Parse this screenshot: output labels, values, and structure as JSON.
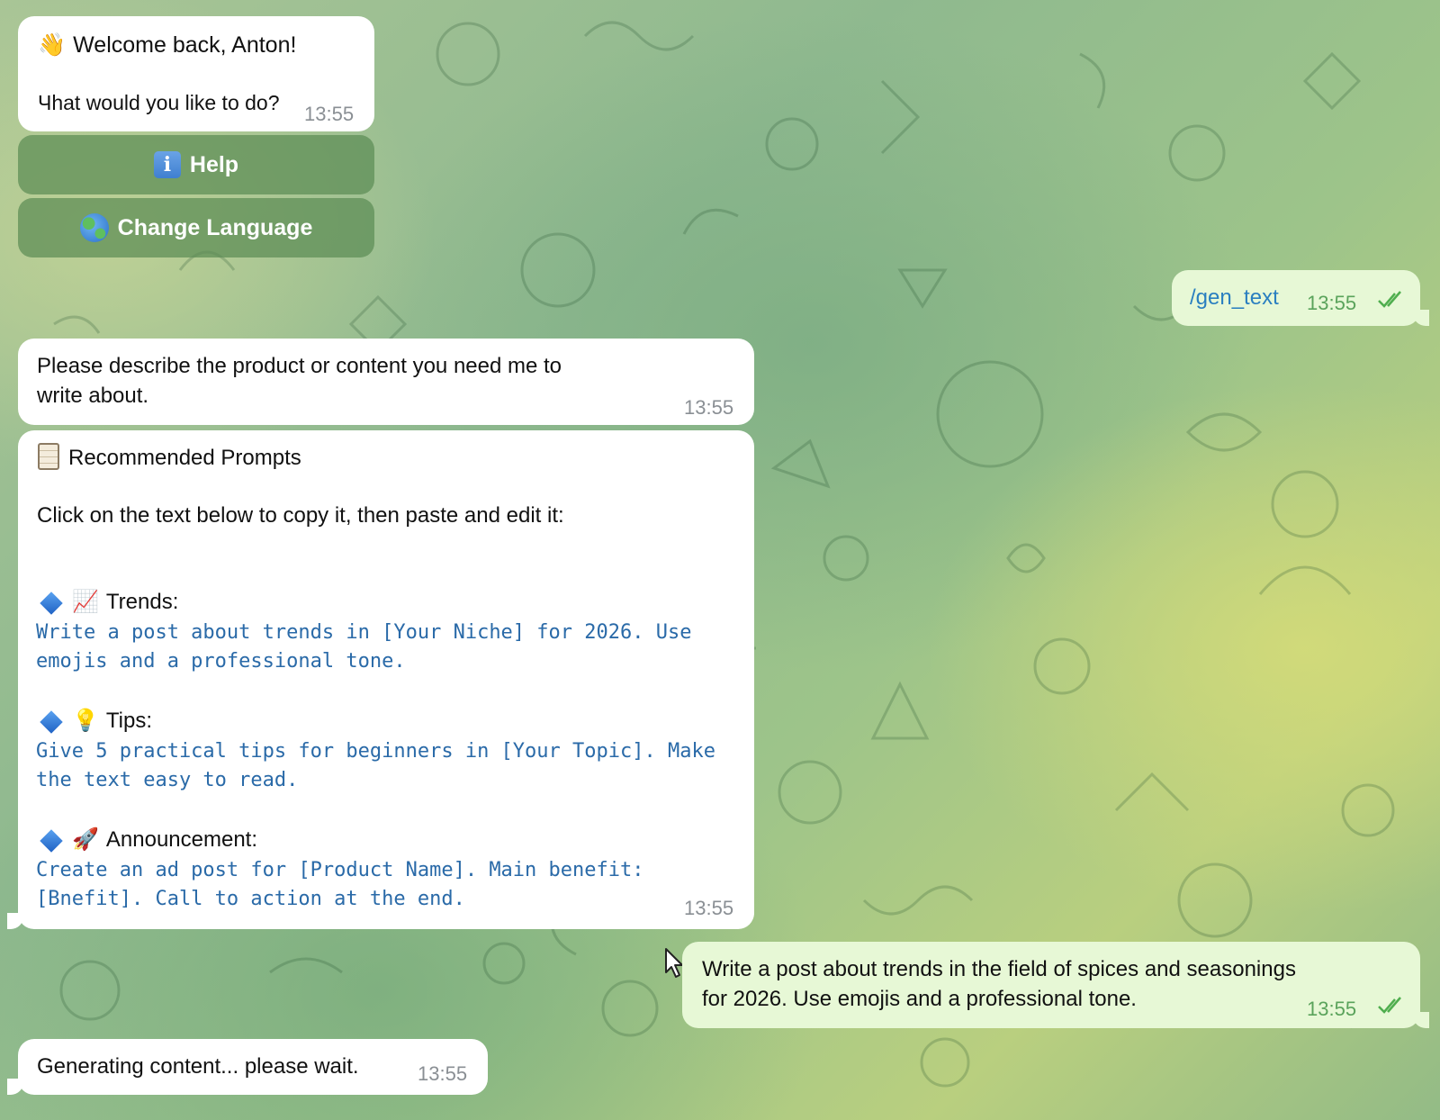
{
  "messages": {
    "welcome": {
      "greeting_emoji": "👋",
      "title": "Welcome back, Anton!",
      "subtitle": "Чhat would you like to do?",
      "time": "13:55"
    },
    "keyboard": {
      "help_label": "Help",
      "help_icon": "info-icon",
      "language_label": "Change Language",
      "language_icon": "globe-icon"
    },
    "command": {
      "text": "/gen_text",
      "time": "13:55"
    },
    "describe": {
      "text_line1": "Please describe the product or content you need me to",
      "text_line2": "write about.",
      "time": "13:55"
    },
    "prompts": {
      "header_icon": "clipboard-icon",
      "header": "Recommended Prompts",
      "instruction": "Click on the text below to copy it, then paste and edit it:",
      "items": [
        {
          "icon": "chart-increasing-icon",
          "emoji": "📈",
          "label": "Trends:",
          "code_line1": "Write a post about trends in [Your Niche] for 2026. Use",
          "code_line2": "emojis and a professional tone."
        },
        {
          "icon": "light-bulb-icon",
          "emoji": "💡",
          "label": "Tips:",
          "code_line1": "Give 5 practical tips for beginners in [Your Topic]. Make",
          "code_line2": "the text easy to read."
        },
        {
          "icon": "rocket-icon",
          "emoji": "🚀",
          "label": "Announcement:",
          "code_line1": "Create an ad post for [Product Name]. Main benefit:",
          "code_line2": "[Bnefit]. Call to action at the end."
        }
      ],
      "time": "13:55"
    },
    "user_prompt": {
      "text_line1": "Write a post about trends in the field of spices and seasonings",
      "text_line2": "for 2026. Use emojis and a professional tone.",
      "time": "13:55"
    },
    "generating": {
      "text": "Generating content... please wait.",
      "time": "13:55"
    }
  },
  "colors": {
    "incoming_bubble": "#ffffff",
    "outgoing_bubble": "#e7f8d6",
    "keyboard_button": "#5c8c54",
    "code_text": "#2a6aa8",
    "read_checks": "#4fae4e"
  }
}
